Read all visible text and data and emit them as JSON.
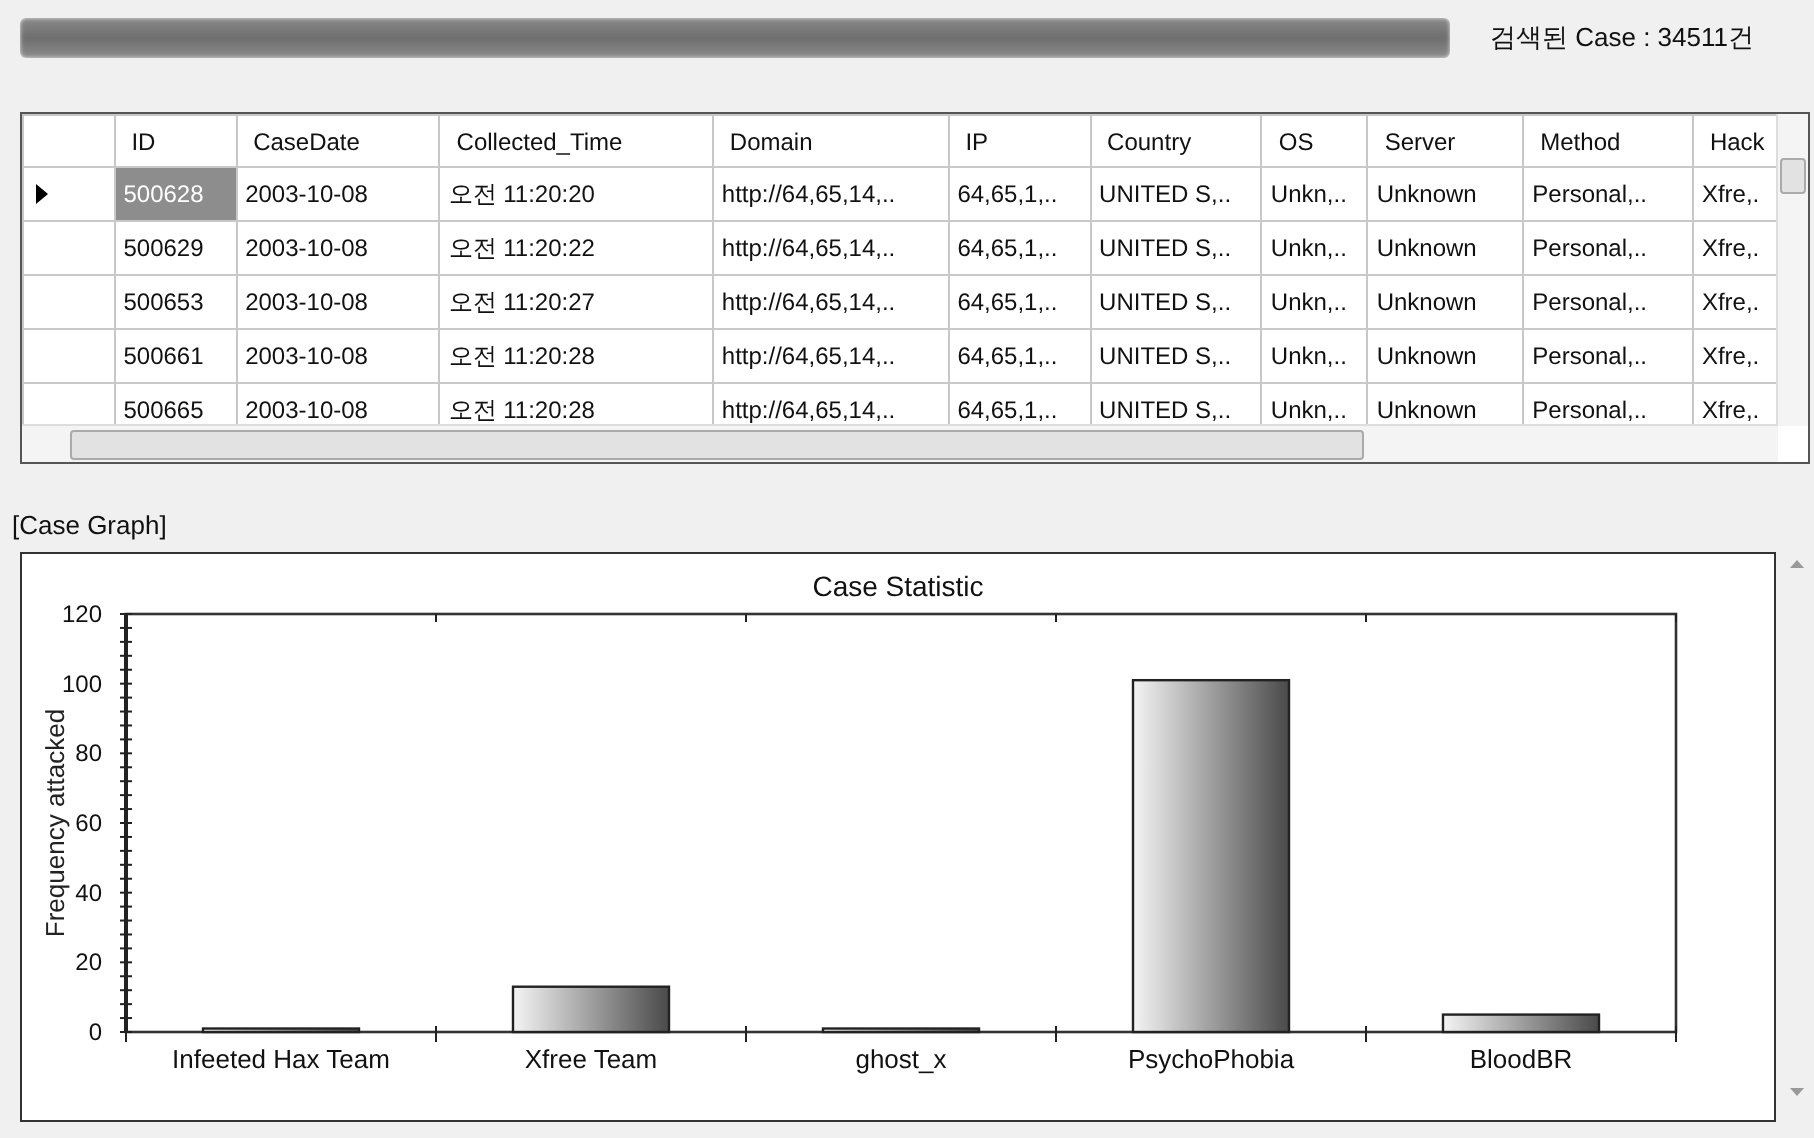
{
  "top_bar": {
    "progress": {
      "level": 1
    },
    "result_count": "검색된 Case : 34511건"
  },
  "table": {
    "columns": [
      "ID",
      "CaseDate",
      "Collected_Time",
      "Domain",
      "IP",
      "Country",
      "OS",
      "Server",
      "Method",
      "Hack"
    ],
    "rows": [
      {
        "selected": true,
        "cells": [
          "500628",
          "2003-10-08",
          "오전 11:20:20",
          "http://64,65,14,..",
          "64,65,1,..",
          "UNITED S,..",
          "Unkn,..",
          "Unknown",
          "Personal,..",
          "Xfre,."
        ]
      },
      {
        "selected": false,
        "cells": [
          "500629",
          "2003-10-08",
          "오전 11:20:22",
          "http://64,65,14,..",
          "64,65,1,..",
          "UNITED S,..",
          "Unkn,..",
          "Unknown",
          "Personal,..",
          "Xfre,."
        ]
      },
      {
        "selected": false,
        "cells": [
          "500653",
          "2003-10-08",
          "오전 11:20:27",
          "http://64,65,14,..",
          "64,65,1,..",
          "UNITED S,..",
          "Unkn,..",
          "Unknown",
          "Personal,..",
          "Xfre,."
        ]
      },
      {
        "selected": false,
        "cells": [
          "500661",
          "2003-10-08",
          "오전 11:20:28",
          "http://64,65,14,..",
          "64,65,1,..",
          "UNITED S,..",
          "Unkn,..",
          "Unknown",
          "Personal,..",
          "Xfre,."
        ]
      },
      {
        "selected": false,
        "cells": [
          "500665",
          "2003-10-08",
          "오전 11:20:28",
          "http://64,65,14,..",
          "64,65,1,..",
          "UNITED S,..",
          "Unkn,..",
          "Unknown",
          "Personal,..",
          "Xfre,."
        ]
      }
    ]
  },
  "graph_section": {
    "label": "[Case Graph]",
    "chart_data": {
      "type": "bar",
      "title": "Case Statistic",
      "ylabel": "Frequency attacked",
      "categories": [
        "Infeeted Hax Team",
        "Xfree Team",
        "ghost_x",
        "PsychoPhobia",
        "BloodBR"
      ],
      "values": [
        1,
        13,
        1,
        101,
        5
      ],
      "ylim": [
        0,
        120
      ],
      "yticks": [
        0,
        20,
        40,
        60,
        80,
        100,
        120
      ]
    }
  }
}
